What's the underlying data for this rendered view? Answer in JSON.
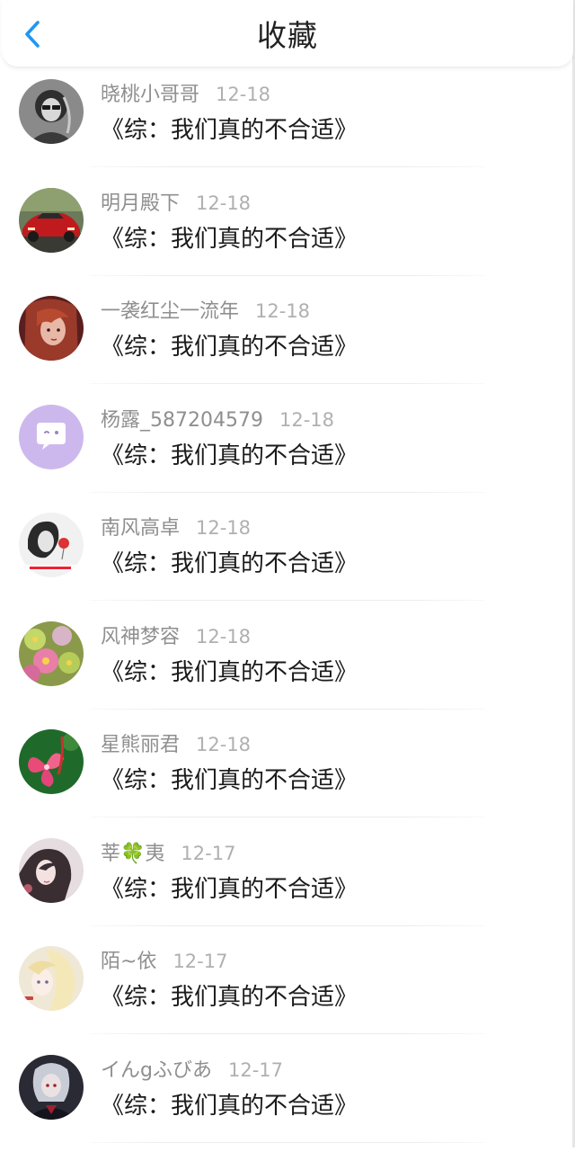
{
  "header": {
    "title": "收藏",
    "back_icon": "chevron-left-icon",
    "accent_color": "#2196f3"
  },
  "items": [
    {
      "user": "晓桃小哥哥",
      "date": "12-18",
      "title": "《综：我们真的不合适》",
      "avatar": "avatar-grayscale-portrait"
    },
    {
      "user": "明月殿下",
      "date": "12-18",
      "title": "《综：我们真的不合适》",
      "avatar": "avatar-red-car"
    },
    {
      "user": "一袭红尘一流年",
      "date": "12-18",
      "title": "《综：我们真的不合适》",
      "avatar": "avatar-red-hair-girl"
    },
    {
      "user": "杨露_587204579",
      "date": "12-18",
      "title": "《综：我们真的不合适》",
      "avatar": "avatar-default-chat-bubble"
    },
    {
      "user": "南风高卓",
      "date": "12-18",
      "title": "《综：我们真的不合适》",
      "avatar": "avatar-sketch-girl"
    },
    {
      "user": "风神梦容",
      "date": "12-18",
      "title": "《综：我们真的不合适》",
      "avatar": "avatar-succulent-plants"
    },
    {
      "user": "星熊丽君",
      "date": "12-18",
      "title": "《综：我们真的不合适》",
      "avatar": "avatar-pink-flower"
    },
    {
      "user": "莘🍀夷",
      "date": "12-17",
      "title": "《综：我们真的不合适》",
      "avatar": "avatar-dark-hair-girl"
    },
    {
      "user": "陌~依",
      "date": "12-17",
      "title": "《综：我们真的不合适》",
      "avatar": "avatar-anime-blonde"
    },
    {
      "user": "イんgふびあ",
      "date": "12-17",
      "title": "《综：我们真的不合适》",
      "avatar": "avatar-anime-dark"
    }
  ]
}
